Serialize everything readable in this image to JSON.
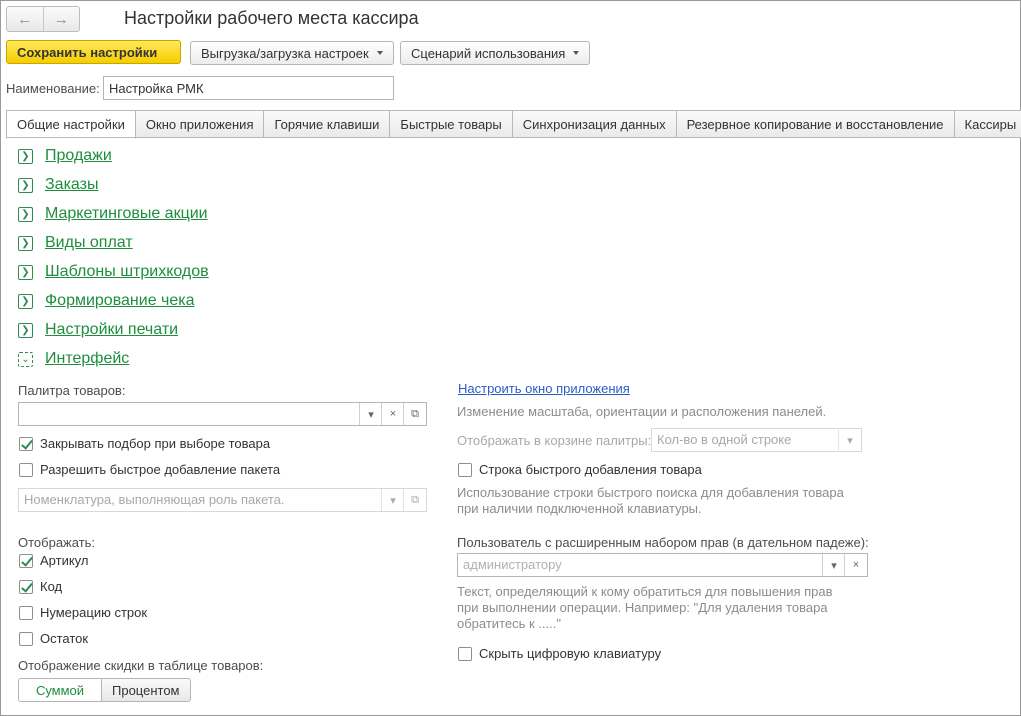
{
  "window": {
    "title": "Настройки рабочего места кассира"
  },
  "nav": {
    "back_icon": "←",
    "forward_icon": "→"
  },
  "toolbar": {
    "save_label": "Сохранить настройки",
    "export_label": "Выгрузка/загрузка настроек",
    "scenario_label": "Сценарий использования"
  },
  "name_field": {
    "label": "Наименование:",
    "value": "Настройка РМК"
  },
  "tabs": [
    "Общие настройки",
    "Окно приложения",
    "Горячие клавиши",
    "Быстрые товары",
    "Синхронизация данных",
    "Резервное копирование и восстановление",
    "Кассиры"
  ],
  "groups": [
    "Продажи",
    "Заказы",
    "Маркетинговые акции",
    "Виды оплат",
    "Шаблоны штрихкодов",
    "Формирование чека",
    "Настройки печати",
    "Интерфейс"
  ],
  "left": {
    "palette_label": "Палитра товаров:",
    "palette_value": "",
    "close_pick_label": "Закрывать подбор при выборе товара",
    "close_pick_checked": true,
    "fast_package_label": "Разрешить быстрое добавление пакета",
    "fast_package_checked": false,
    "package_placeholder": "Номенклатура, выполняющая роль пакета.",
    "show_label": "Отображать:",
    "show_items": [
      {
        "label": "Артикул",
        "checked": true
      },
      {
        "label": "Код",
        "checked": true
      },
      {
        "label": "Нумерацию строк",
        "checked": false
      },
      {
        "label": "Остаток",
        "checked": false
      }
    ],
    "discount_label": "Отображение скидки в таблице товаров:",
    "discount_sum": "Суммой",
    "discount_percent": "Процентом"
  },
  "right": {
    "configure_link": "Настроить окно приложения",
    "configure_hint": "Изменение масштаба, ориентации и расположения панелей.",
    "cart_palette_label": "Отображать в корзине палитры:",
    "cart_palette_value": "Кол-во в одной строке",
    "quick_add_label": "Строка быстрого добавления товара",
    "quick_add_hint_1": "Использование строки быстрого поиска для добавления товара",
    "quick_add_hint_2": "при наличии подключенной клавиатуры.",
    "admin_user_label": "Пользователь с расширенным набором прав (в дательном падеже):",
    "admin_user_placeholder": "администратору",
    "admin_hint_1": "Текст, определяющий к кому обратиться для повышения прав",
    "admin_hint_2": "при выполнении операции. Например: \"Для удаления товара",
    "admin_hint_3": "обратитесь к .....\"",
    "hide_keypad_label": "Скрыть цифровую клавиатуру"
  },
  "colors": {
    "accent": "#1e8e3e",
    "primary_button": "#f5cd00",
    "link": "#2b5cc6"
  }
}
